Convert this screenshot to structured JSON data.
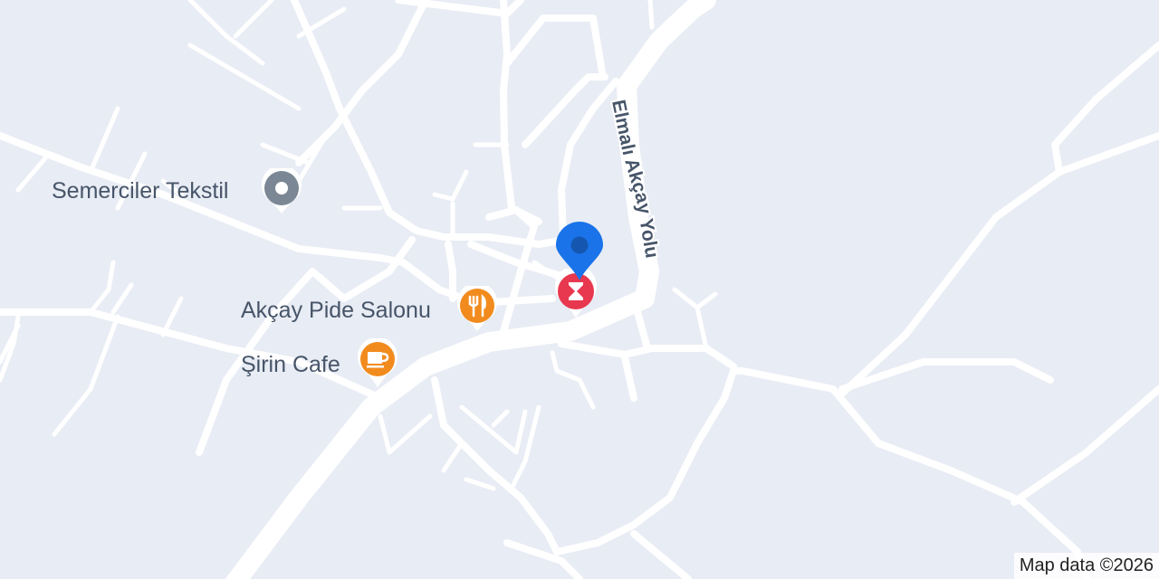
{
  "map": {
    "road_label": "Elmalı Akçay Yolu",
    "attribution": "Map data ©2026",
    "colors": {
      "background": "#e8ecf4",
      "road": "#ffffff",
      "road_label": "#475569",
      "pin_blue": "#1a73e8",
      "poi_orange": "#f28b1e",
      "poi_gray": "#7b8794",
      "poi_red": "#e8384f"
    }
  },
  "pois": [
    {
      "name": "Semerciler Tekstil",
      "icon": "place-gray-icon"
    },
    {
      "name": "Akçay Pide Salonu",
      "icon": "restaurant-icon"
    },
    {
      "name": "Şirin Cafe",
      "icon": "cafe-icon"
    }
  ],
  "markers": [
    {
      "name": "selected-location-pin",
      "icon": "location-pin-icon"
    },
    {
      "name": "museum-marker",
      "icon": "museum-icon"
    }
  ]
}
